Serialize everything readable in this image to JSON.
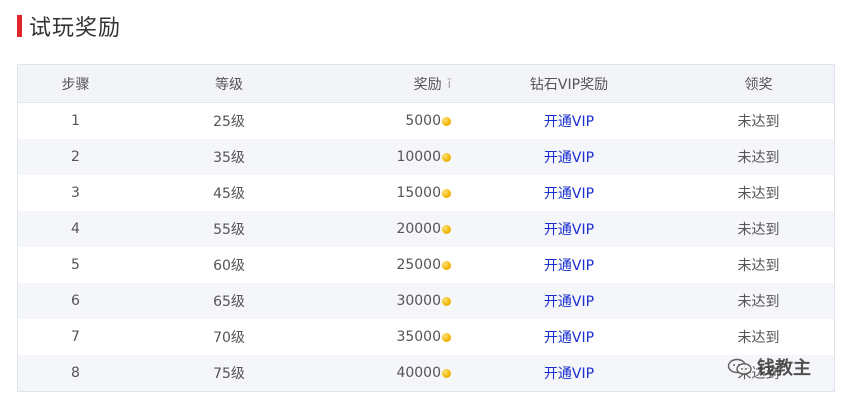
{
  "section": {
    "title": "试玩奖励",
    "accent_color": "#e0262a"
  },
  "table": {
    "headers": {
      "step": "步骤",
      "level": "等级",
      "reward": "奖励",
      "reward_tail": "ī",
      "vip_reward": "钻石VIP奖励",
      "claim": "领奖"
    },
    "rows": [
      {
        "step": "1",
        "level": "25级",
        "reward": "5000",
        "vip": "开通VIP",
        "claim": "未达到"
      },
      {
        "step": "2",
        "level": "35级",
        "reward": "10000",
        "vip": "开通VIP",
        "claim": "未达到"
      },
      {
        "step": "3",
        "level": "45级",
        "reward": "15000",
        "vip": "开通VIP",
        "claim": "未达到"
      },
      {
        "step": "4",
        "level": "55级",
        "reward": "20000",
        "vip": "开通VIP",
        "claim": "未达到"
      },
      {
        "step": "5",
        "level": "60级",
        "reward": "25000",
        "vip": "开通VIP",
        "claim": "未达到"
      },
      {
        "step": "6",
        "level": "65级",
        "reward": "30000",
        "vip": "开通VIP",
        "claim": "未达到"
      },
      {
        "step": "7",
        "level": "70级",
        "reward": "35000",
        "vip": "开通VIP",
        "claim": "未达到"
      },
      {
        "step": "8",
        "level": "75级",
        "reward": "40000",
        "vip": "开通VIP",
        "claim": "未达到"
      }
    ],
    "vip_link_color": "#1a2ed0",
    "coin_icon": "gold-coin-icon"
  },
  "watermark": {
    "text": "钱教主",
    "icon": "wechat-icon"
  }
}
